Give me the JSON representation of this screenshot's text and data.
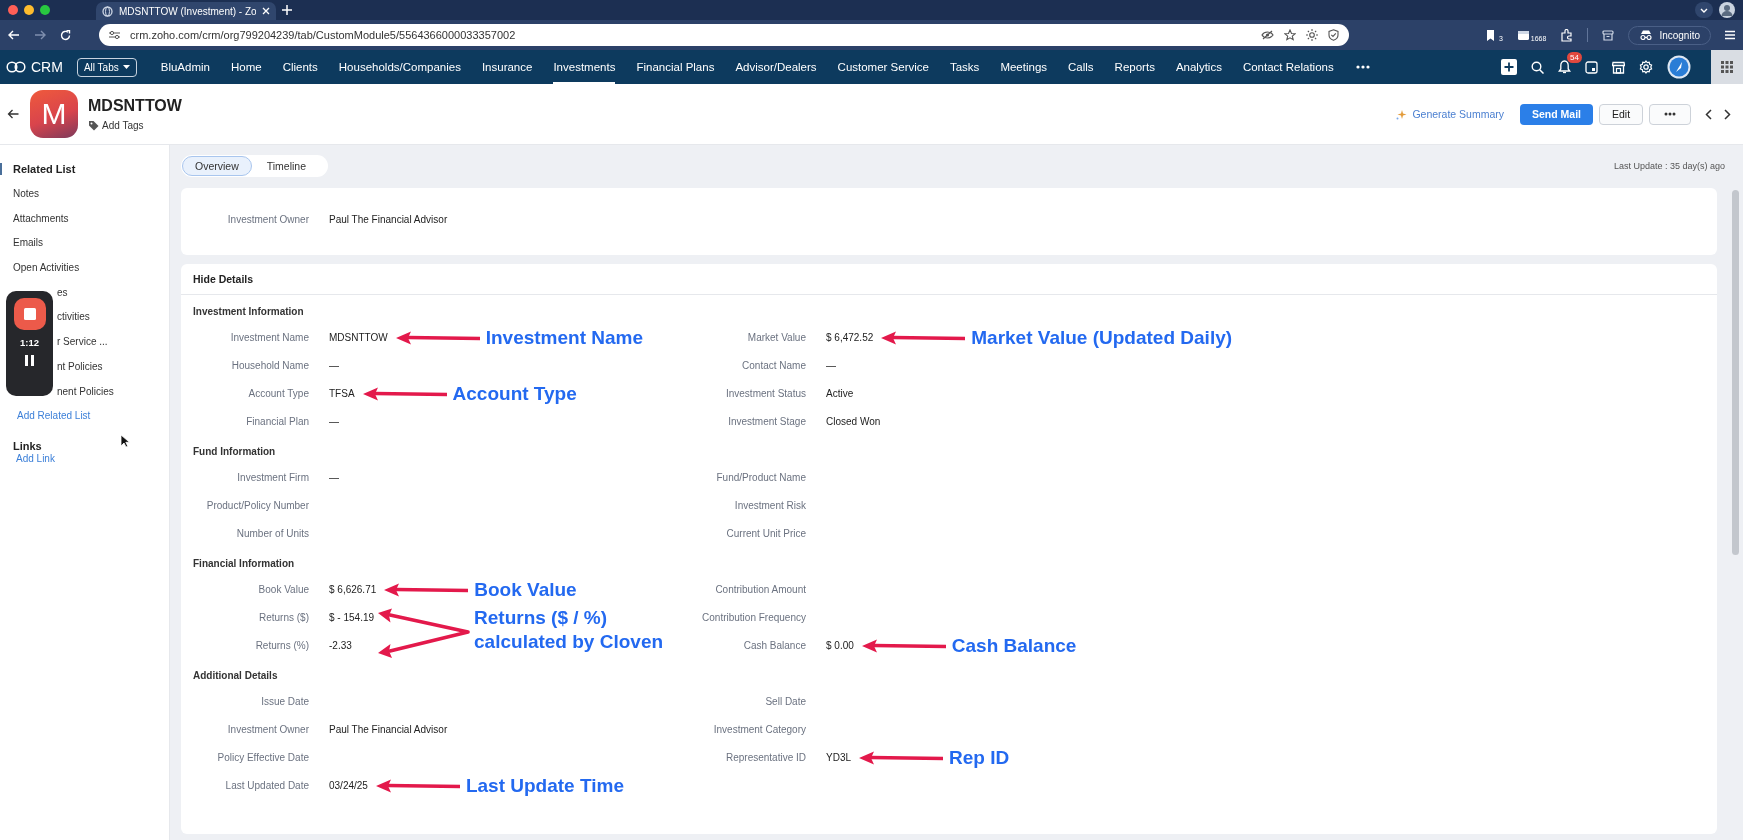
{
  "browser": {
    "tab_title": "MDSNTTOW (Investment) - Zo",
    "url": "crm.zoho.com/crm/org799204239/tab/CustomModule5/5564366000033357002",
    "extension_badges": [
      "3",
      "1668"
    ],
    "incognito": "Incognito"
  },
  "app_nav": {
    "logo": "CRM",
    "all_tabs": "All Tabs",
    "notification_count": "54",
    "items": [
      {
        "label": "BluAdmin",
        "selected": false
      },
      {
        "label": "Home",
        "selected": false
      },
      {
        "label": "Clients",
        "selected": false
      },
      {
        "label": "Households/Companies",
        "selected": false
      },
      {
        "label": "Insurance",
        "selected": false
      },
      {
        "label": "Investments",
        "selected": true
      },
      {
        "label": "Financial Plans",
        "selected": false
      },
      {
        "label": "Advisor/Dealers",
        "selected": false
      },
      {
        "label": "Customer Service",
        "selected": false
      },
      {
        "label": "Tasks",
        "selected": false
      },
      {
        "label": "Meetings",
        "selected": false
      },
      {
        "label": "Calls",
        "selected": false
      },
      {
        "label": "Reports",
        "selected": false
      },
      {
        "label": "Analytics",
        "selected": false
      },
      {
        "label": "Contact Relations",
        "selected": false
      }
    ]
  },
  "record": {
    "initial": "M",
    "title": "MDSNTTOW",
    "add_tags": "Add Tags",
    "generate_summary": "Generate Summary",
    "send_mail": "Send Mail",
    "edit": "Edit"
  },
  "view_tabs": [
    {
      "label": "Overview",
      "selected": true
    },
    {
      "label": "Timeline",
      "selected": false
    }
  ],
  "last_update": "Last Update : 35 day(s) ago",
  "sidebar": {
    "title": "Related List",
    "items": [
      {
        "label": "Notes",
        "kind": "item"
      },
      {
        "label": "Attachments",
        "kind": "item"
      },
      {
        "label": "Emails",
        "kind": "item"
      },
      {
        "label": "Open Activities",
        "kind": "item"
      },
      {
        "label": "es",
        "kind": "clipped"
      },
      {
        "label": "ctivities",
        "kind": "clipped"
      },
      {
        "label": "r Service ...",
        "kind": "clipped"
      },
      {
        "label": "nt Policies",
        "kind": "clipped"
      },
      {
        "label": "nent Policies",
        "kind": "clipped"
      },
      {
        "label": "Add Related List",
        "kind": "link"
      }
    ],
    "links_title": "Links",
    "add_link": "Add Link"
  },
  "recorder": {
    "time": "1:12"
  },
  "owner_card": {
    "fields": [
      {
        "label": "Investment Owner",
        "value": "Paul The Financial Advisor"
      }
    ]
  },
  "details": {
    "toggle": "Hide Details",
    "sections": [
      {
        "title": "Investment Information",
        "fields": [
          {
            "label": "Investment Name",
            "value": "MDSNTTOW",
            "annotation": {
              "kind": "arrow",
              "text": "Investment Name"
            }
          },
          {
            "label": "Market Value",
            "value": "$ 6,472.52",
            "annotation": {
              "kind": "arrow",
              "text": "Market Value (Updated Daily)"
            }
          },
          {
            "label": "Household Name",
            "value": "—"
          },
          {
            "label": "Contact Name",
            "value": "—"
          },
          {
            "label": "Account Type",
            "value": "TFSA",
            "annotation": {
              "kind": "arrow",
              "text": "Account Type"
            }
          },
          {
            "label": "Investment Status",
            "value": "Active"
          },
          {
            "label": "Financial Plan",
            "value": "—"
          },
          {
            "label": "Investment Stage",
            "value": "Closed Won"
          }
        ]
      },
      {
        "title": "Fund Information",
        "fields": [
          {
            "label": "Investment Firm",
            "value": "—"
          },
          {
            "label": "Fund/Product Name"
          },
          {
            "label": "Product/Policy Number"
          },
          {
            "label": "Investment Risk"
          },
          {
            "label": "Number of Units"
          },
          {
            "label": "Current Unit Price"
          }
        ]
      },
      {
        "title": "Financial Information",
        "fields": [
          {
            "label": "Book Value",
            "value": "$ 6,626.71",
            "annotation": {
              "kind": "arrow",
              "text": "Book Value"
            }
          },
          {
            "label": "Contribution Amount"
          },
          {
            "label": "Returns ($)",
            "value": "$ - 154.19",
            "annotation": {
              "kind": "fork",
              "lines": [
                "Returns ($ / %)",
                "calculated by Cloven"
              ]
            }
          },
          {
            "label": "Contribution Frequency"
          },
          {
            "label": "Returns (%)",
            "value": "-2.33"
          },
          {
            "label": "Cash Balance",
            "value": "$ 0.00",
            "annotation": {
              "kind": "arrow",
              "text": "Cash Balance"
            }
          }
        ]
      },
      {
        "title": "Additional Details",
        "fields": [
          {
            "label": "Issue Date"
          },
          {
            "label": "Sell Date"
          },
          {
            "label": "Investment Owner",
            "value": "Paul The Financial Advisor"
          },
          {
            "label": "Investment Category"
          },
          {
            "label": "Policy Effective Date"
          },
          {
            "label": "Representative ID",
            "value": "YD3L",
            "annotation": {
              "kind": "arrow",
              "text": "Rep ID"
            }
          },
          {
            "label": "Last Updated Date",
            "value": "03/24/25",
            "annotation": {
              "kind": "arrow",
              "text": "Last Update Time"
            }
          }
        ]
      }
    ]
  }
}
